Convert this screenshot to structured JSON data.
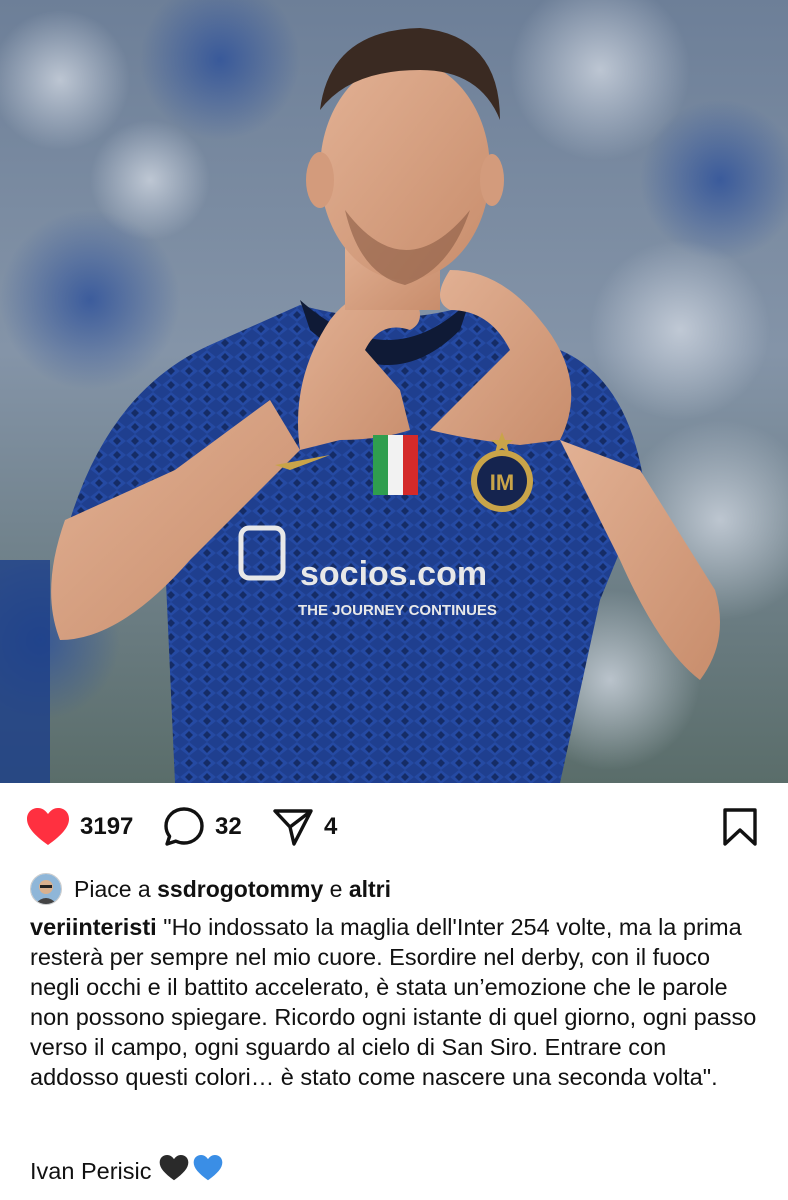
{
  "post": {
    "image_alt": "Calciatore con maglia nerazzurra che forma un cuore con le mani",
    "jersey": {
      "sponsor": "socios.com",
      "sponsor_tagline": "THE JOURNEY CONTINUES"
    }
  },
  "actions": {
    "likes": "3197",
    "comments": "32",
    "shares": "4"
  },
  "liked_by": {
    "prefix": "Piace a",
    "user": "ssdrogotommy",
    "conj": "e",
    "others": "altri"
  },
  "caption": {
    "username": "veriinteristi",
    "text": "\"Ho indossato la maglia dell'Inter 254 volte, ma la prima resterà per sempre nel mio cuore. Esordire nel derby, con il fuoco negli occhi e il battito accelerato, è stata un’emozione che le parole non possono spiegare. Ricordo ogni istante di quel giorno, ogni passo verso il campo, ogni sguardo al cielo di San Siro. Entrare con addosso questi colori… è stato come nascere una seconda volta\".",
    "signature": "Ivan Perisic"
  },
  "colors": {
    "like_red": "#ff3040",
    "jersey_blue": "#1f3f8f",
    "jersey_black": "#0f1a36",
    "skin": "#d9a585"
  },
  "icons": [
    "heart-icon",
    "comment-icon",
    "share-icon",
    "bookmark-icon"
  ]
}
